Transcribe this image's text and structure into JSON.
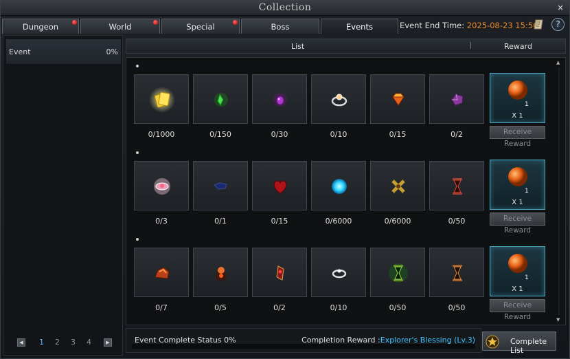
{
  "window": {
    "title": "Collection",
    "close_glyph": "×"
  },
  "tabs": [
    {
      "label": "Dungeon",
      "notify": true
    },
    {
      "label": "World",
      "notify": true
    },
    {
      "label": "Special",
      "notify": true
    },
    {
      "label": "Boss",
      "notify": false
    },
    {
      "label": "Events",
      "notify": false,
      "active": true
    }
  ],
  "header": {
    "event_end_label": "Event End Time: ",
    "event_end_date": "2025-08-23 15:56",
    "help_glyph": "?"
  },
  "sidebar": {
    "items": [
      {
        "name": "Event",
        "percent": "0%"
      }
    ],
    "pager": {
      "prev": "◀",
      "next": "▶",
      "pages": [
        "1",
        "2",
        "3",
        "4"
      ],
      "current": "1"
    }
  },
  "list": {
    "col_list": "List",
    "col_reward": "Reward",
    "scroll_up": "▲",
    "scroll_down": "▼",
    "rows": [
      {
        "items": [
          {
            "icon": "gold-ticket-icon",
            "count": "0/1000"
          },
          {
            "icon": "green-crystal-icon",
            "count": "0/150"
          },
          {
            "icon": "purple-gem-icon",
            "count": "0/30"
          },
          {
            "icon": "ring-icon",
            "count": "0/10"
          },
          {
            "icon": "orange-gem-icon",
            "count": "0/15"
          },
          {
            "icon": "purple-stone-icon",
            "count": "0/2"
          }
        ],
        "reward": {
          "icon": "orange-orb-icon",
          "qty": "1",
          "qty_label": "X 1"
        },
        "receive_label": "Receive Reward"
      },
      {
        "items": [
          {
            "icon": "pink-jewel-icon",
            "count": "0/3"
          },
          {
            "icon": "dark-fragment-icon",
            "count": "0/1"
          },
          {
            "icon": "red-heart-icon",
            "count": "0/15"
          },
          {
            "icon": "blue-orb-icon",
            "count": "0/6000"
          },
          {
            "icon": "gold-cross-icon",
            "count": "0/6000"
          },
          {
            "icon": "red-hourglass-icon",
            "count": "0/50"
          }
        ],
        "reward": {
          "icon": "orange-orb-icon",
          "qty": "1",
          "qty_label": "X 1"
        },
        "receive_label": "Receive Reward"
      },
      {
        "items": [
          {
            "icon": "fire-ore-icon",
            "count": "0/7"
          },
          {
            "icon": "ember-icon",
            "count": "0/5"
          },
          {
            "icon": "red-crystal-icon",
            "count": "0/2"
          },
          {
            "icon": "silver-ring-icon",
            "count": "0/10"
          },
          {
            "icon": "green-hourglass-icon",
            "count": "0/50"
          },
          {
            "icon": "orange-hourglass-icon",
            "count": "0/50"
          }
        ],
        "reward": {
          "icon": "orange-orb-icon",
          "qty": "1",
          "qty_label": "X 1"
        },
        "receive_label": "Receive Reward"
      }
    ]
  },
  "footer": {
    "status_label": "Event Complete Status 0%",
    "completion_label": "Completion Reward :",
    "completion_value": "Explorer's Blessing (Lv.3)",
    "complete_list_label": "Complete List"
  },
  "colors": {
    "accent_blue": "#44c4ff",
    "date_orange": "#e88a2a",
    "notify_red": "#c00000",
    "reward_border": "#4fa6bf"
  }
}
